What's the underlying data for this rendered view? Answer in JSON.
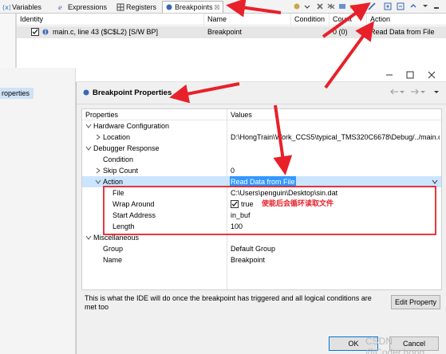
{
  "views": {
    "tabs": [
      {
        "label": "Variables"
      },
      {
        "label": "Expressions"
      },
      {
        "label": "Registers"
      },
      {
        "label": "Breakpoints"
      }
    ],
    "breakpoints_tab_close": "☒"
  },
  "breakpoints": {
    "columns": [
      "Identity",
      "Name",
      "Condition",
      "Count",
      "Action"
    ],
    "rows": [
      {
        "identity": "main.c, line 43 ($C$L2)  [S/W BP]",
        "name": "Breakpoint",
        "condition": "",
        "count": "0 (0)",
        "action": "Read Data from File",
        "checked": true
      }
    ]
  },
  "background": {
    "title_fragment": "or",
    "left_item": "roperties"
  },
  "dialog": {
    "title": "Breakpoint Properties",
    "columns": [
      "Properties",
      "Values"
    ],
    "sections": [
      {
        "label": "Hardware Configuration",
        "rows": [
          {
            "prop": "Location",
            "value": "D:\\HongTrain\\Work_CCS5\\typical_TMS320C6678\\Debug/../main.c"
          }
        ]
      },
      {
        "label": "Debugger Response",
        "rows": [
          {
            "prop": "Condition",
            "value": ""
          },
          {
            "prop": "Skip Count",
            "value": "0"
          },
          {
            "prop": "Action",
            "value": "Read Data from File"
          },
          {
            "prop": "File",
            "value": "C:\\Users\\penguin\\Desktop\\sin.dat"
          },
          {
            "prop": "Wrap Around",
            "value": "true"
          },
          {
            "prop": "Start Address",
            "value": "in_buf"
          },
          {
            "prop": "Length",
            "value": "100"
          }
        ]
      },
      {
        "label": "Miscellaneous",
        "rows": [
          {
            "prop": "Group",
            "value": "Default Group"
          },
          {
            "prop": "Name",
            "value": "Breakpoint"
          }
        ]
      }
    ],
    "annotation": "使能后会循环读取文件",
    "description": "This is what the IDE will do once the breakpoint has triggered and all logical conditions are met too",
    "edit_button": "Edit Property",
    "ok_button": "OK",
    "cancel_button": "Cancel"
  },
  "watermark": "CSDN @Coder.hong",
  "colors": {
    "annotation_red": "#e8202a",
    "selection_blue": "#3399ff",
    "tab_active": "#ffffff"
  }
}
